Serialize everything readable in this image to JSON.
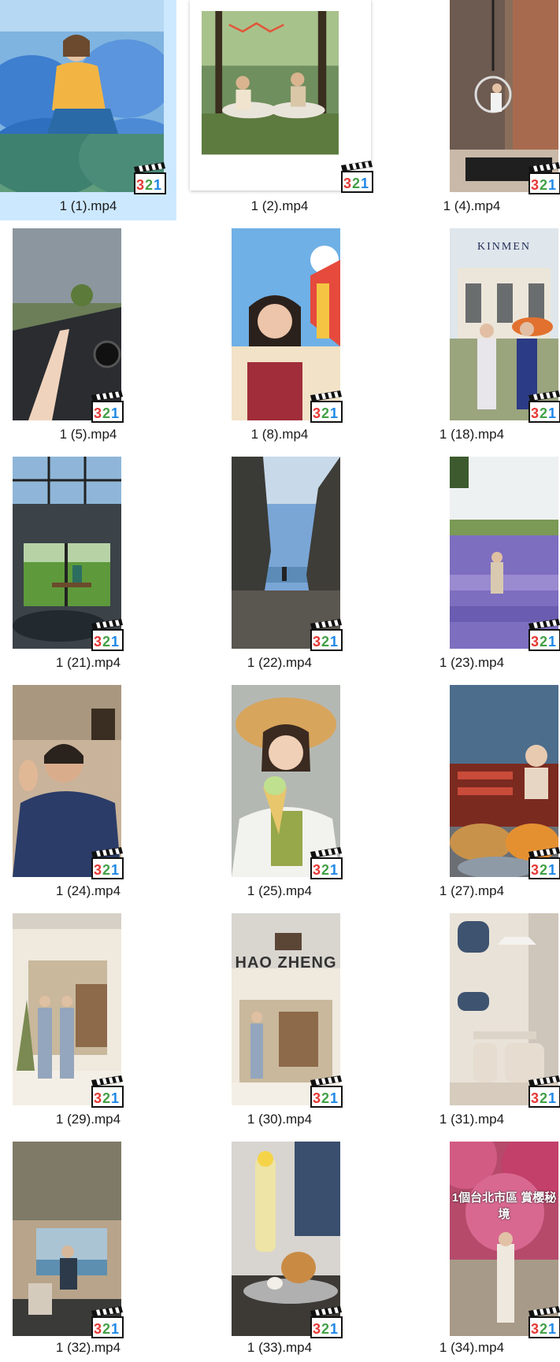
{
  "files": [
    {
      "name": "1 (1).mp4",
      "selected": true
    },
    {
      "name": "1 (2).mp4"
    },
    {
      "name": "1 (4).mp4"
    },
    {
      "name": "1 (5).mp4"
    },
    {
      "name": "1 (8).mp4"
    },
    {
      "name": "1 (18).mp4"
    },
    {
      "name": "1 (21).mp4"
    },
    {
      "name": "1 (22).mp4"
    },
    {
      "name": "1 (23).mp4"
    },
    {
      "name": "1 (24).mp4"
    },
    {
      "name": "1 (25).mp4"
    },
    {
      "name": "1 (27).mp4"
    },
    {
      "name": "1 (29).mp4"
    },
    {
      "name": "1 (30).mp4"
    },
    {
      "name": "1 (31).mp4"
    },
    {
      "name": "1 (32).mp4"
    },
    {
      "name": "1 (33).mp4"
    },
    {
      "name": "1 (34).mp4"
    }
  ],
  "thumb_overlays": {
    "kinmen": "KINMEN",
    "hao_zheng": "HAO ZHENG",
    "taipei": "1個台北市區 賞櫻秘境"
  },
  "badge": {
    "icon": "media-player-classic-icon",
    "label": "321",
    "colors": [
      "#e53935",
      "#43a047",
      "#1e88e5"
    ]
  },
  "colors": {
    "selection": "#cce8ff",
    "text": "#1a1a1a"
  }
}
